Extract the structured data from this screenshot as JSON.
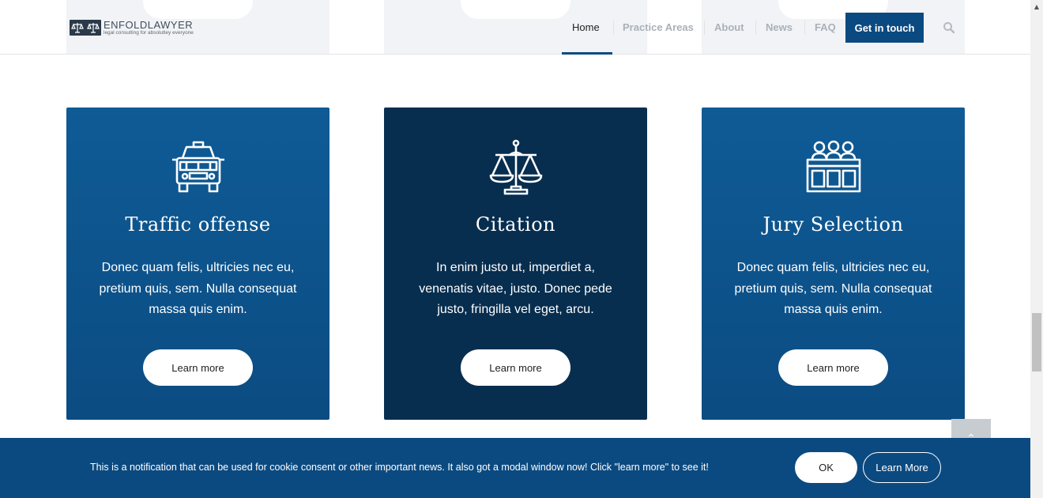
{
  "header": {
    "logo": {
      "name_light": "ENFOLD",
      "name_bold": "LAWYER",
      "tagline": "legal consulting for absolutley everyone"
    },
    "nav": [
      {
        "label": "Home",
        "active": true
      },
      {
        "label": "Practice Areas",
        "active": false
      },
      {
        "label": "About",
        "active": false
      },
      {
        "label": "News",
        "active": false
      },
      {
        "label": "FAQ",
        "active": false
      }
    ],
    "cta_label": "Get in touch",
    "search_icon": "search-icon"
  },
  "cards": [
    {
      "icon": "police-car-icon",
      "title": "Traffic offense",
      "body": "Donec quam felis, ultricies nec eu, pretium quis, sem. Nulla consequat massa quis enim.",
      "button": "Learn more",
      "color": "#0f5b96"
    },
    {
      "icon": "scales-of-justice-icon",
      "title": "Citation",
      "body": "In enim justo ut, imperdiet a, venenatis vitae, justo. Donec pede justo, fringilla vel eget, arcu.",
      "button": "Learn more",
      "color": "#072e4f"
    },
    {
      "icon": "jury-box-icon",
      "title": "Jury Selection",
      "body": "Donec quam felis, ultricies nec eu, pretium quis, sem. Nulla consequat massa quis enim.",
      "button": "Learn more",
      "color": "#0f5b96"
    }
  ],
  "cookie_bar": {
    "message": "This is a notification that can be used for cookie consent or other important news. It also got a modal window now! Click \"learn more\" to see it!",
    "ok_label": "OK",
    "learn_more_label": "Learn More"
  },
  "back_to_top_icon": "chevron-up-icon",
  "colors": {
    "brand": "#0b4a80",
    "dark": "#072e4f"
  }
}
